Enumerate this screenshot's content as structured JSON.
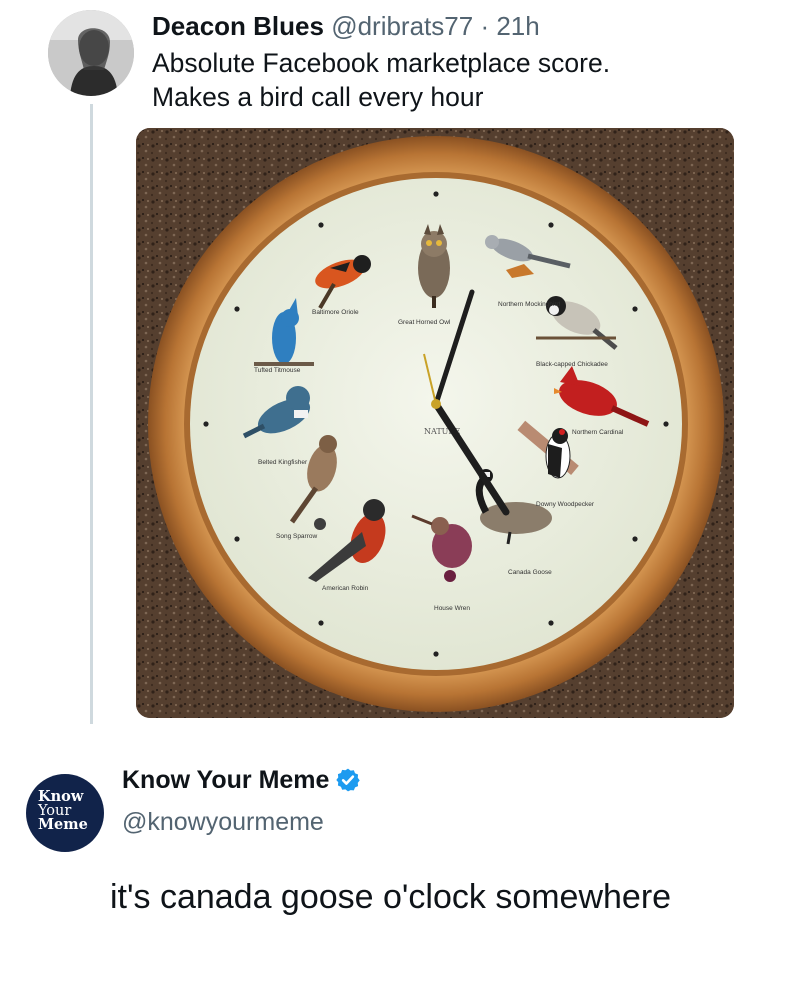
{
  "tweet": {
    "display_name": "Deacon Blues",
    "handle": "@dribrats77",
    "separator": "·",
    "time": "21h",
    "text_line1": "Absolute Facebook marketplace score.",
    "text_line2": "Makes a bird call every hour"
  },
  "clock_photo": {
    "birds": {
      "twelve": "Great Horned Owl",
      "one": "Northern Mockingbird",
      "two": "Black-capped Chickadee",
      "three": "Northern Cardinal",
      "four": "Downy Woodpecker",
      "five": "Canada Goose",
      "six": "House Wren",
      "seven": "American Robin",
      "eight": "Song Sparrow",
      "nine": "Belted Kingfisher",
      "ten": "Tufted Titmouse",
      "eleven": "Baltimore Oriole"
    },
    "center_brand": "NATURE",
    "colors": {
      "frame": "#c98a45",
      "face": "#eef1e4",
      "hands": "#1e1e1e",
      "second_hand": "#c9a227",
      "countertop": "#5b4434"
    }
  },
  "reply": {
    "logo_line1": "Know",
    "logo_line2": "Your",
    "logo_line3": "Meme",
    "display_name": "Know Your Meme",
    "handle": "@knowyourmeme",
    "text": "it's canada goose o'clock somewhere",
    "verified_icon": "verified-badge-icon",
    "accent_color": "#1d9bf0"
  }
}
